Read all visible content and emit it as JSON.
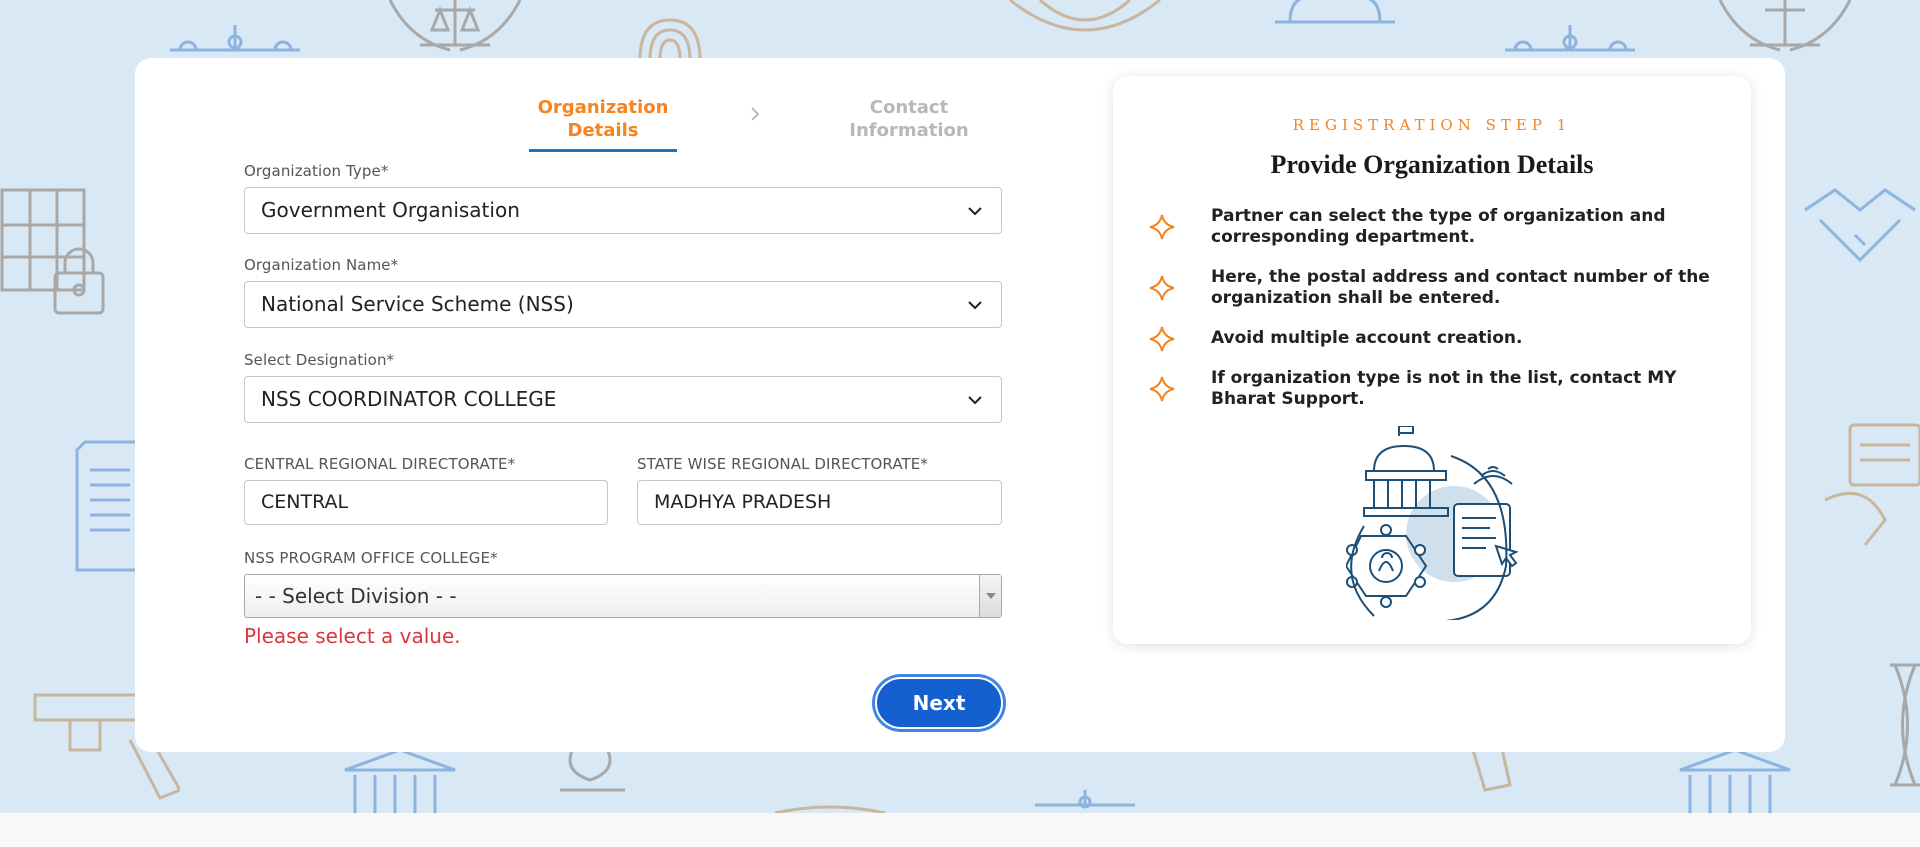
{
  "stepper": {
    "steps": [
      {
        "label": "Organization Details",
        "state": "active"
      },
      {
        "label": "Contact Information",
        "state": "inactive"
      }
    ]
  },
  "form": {
    "org_type": {
      "label": "Organization Type*",
      "value": "Government Organisation"
    },
    "org_name": {
      "label": "Organization Name*",
      "value": "National Service Scheme (NSS)"
    },
    "designation": {
      "label": "Select Designation*",
      "value": "NSS COORDINATOR COLLEGE"
    },
    "central_directorate": {
      "label": "CENTRAL REGIONAL DIRECTORATE*",
      "value": "CENTRAL"
    },
    "state_directorate": {
      "label": "STATE WISE REGIONAL DIRECTORATE*",
      "value": "MADHYA PRADESH"
    },
    "program_office": {
      "label": "NSS PROGRAM OFFICE COLLEGE*",
      "value": "- - Select Division - -"
    },
    "error": "Please select a value.",
    "next_label": "Next"
  },
  "info": {
    "kicker": "REGISTRATION STEP 1",
    "title": "Provide Organization Details",
    "items": [
      "Partner can select the type of organization and corresponding department.",
      "Here, the postal address and contact number of the organization shall be entered.",
      "Avoid multiple account creation.",
      "If organization type is not in the list, contact MY Bharat Support."
    ],
    "bullet_icon": "sparkle-icon",
    "illustration_icon": "government-digital-services-icon"
  },
  "colors": {
    "accent_orange": "#f5831f",
    "primary_blue": "#1460d0",
    "step_underline": "#1b75bb",
    "error_red": "#d9363e",
    "background": "#d8e8f5"
  }
}
